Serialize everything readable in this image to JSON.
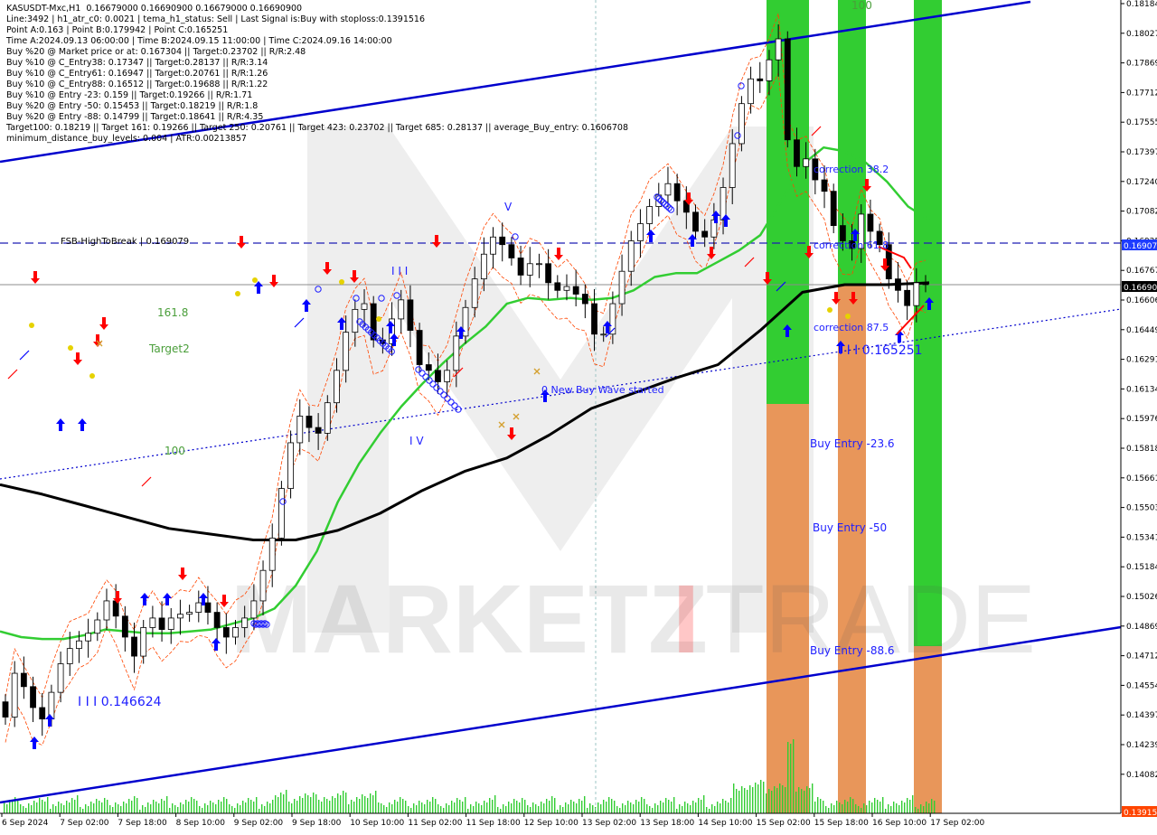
{
  "info_lines": [
    "KASUSDT-Mxc,H1  0.16679000 0.16690900 0.16679000 0.16690900",
    "Line:3492 | h1_atr_c0: 0.0021 | tema_h1_status: Sell | Last Signal is:Buy with stoploss:0.1391516",
    "Point A:0.163 | Point B:0.179942 | Point C:0.165251",
    "Time A:2024.09.13 06:00:00 | Time B:2024.09.15 11:00:00 | Time C:2024.09.16 14:00:00",
    "Buy %20 @ Market price or at: 0.167304 || Target:0.23702 || R/R:2.48",
    "Buy %10 @ C_Entry38: 0.17347 || Target:0.28137 || R/R:3.14",
    "Buy %10 @ C_Entry61: 0.16947 || Target:0.20761 || R/R:1.26",
    "Buy %10 @ C_Entry88: 0.16512 || Target:0.19688 || R/R:1.22",
    "Buy %10 @ Entry -23: 0.159 || Target:0.19266 || R/R:1.71",
    "Buy %20 @ Entry -50: 0.15453 || Target:0.18219 || R/R:1.8",
    "Buy %20 @ Entry -88: 0.14799 || Target:0.18641 || R/R:4.35",
    "Target100: 0.18219 || Target 161: 0.19266 || Target 250: 0.20761 || Target 423: 0.23702 || Target 685: 0.28137 || average_Buy_entry: 0.1606708",
    "minimum_distance_buy_levels: 0.004 | ATR:0.00213857"
  ],
  "watermark": {
    "part1": "MARKETZ",
    "part2": "I",
    "part3": "TRADE"
  },
  "chart_data": {
    "type": "candlestick",
    "symbol": "KASUSDT-Mxc",
    "timeframe": "H1",
    "ylim": [
      0.13915,
      0.18184
    ],
    "y_ticks": [
      "0.18184",
      "0.18027",
      "0.17869",
      "0.17712",
      "0.17555",
      "0.17397",
      "0.17240",
      "0.17082",
      "0.16925",
      "0.16767",
      "0.16606",
      "0.16449",
      "0.16291",
      "0.16134",
      "0.15976",
      "0.15818",
      "0.15661",
      "0.15503",
      "0.15341",
      "0.15184",
      "0.15026",
      "0.14869",
      "0.14712",
      "0.14554",
      "0.14397",
      "0.14239",
      "0.14082"
    ],
    "x_ticks": [
      "6 Sep 2024",
      "7 Sep 02:00",
      "7 Sep 18:00",
      "8 Sep 10:00",
      "9 Sep 02:00",
      "9 Sep 18:00",
      "10 Sep 10:00",
      "11 Sep 02:00",
      "11 Sep 18:00",
      "12 Sep 10:00",
      "13 Sep 02:00",
      "13 Sep 18:00",
      "14 Sep 10:00",
      "15 Sep 02:00",
      "15 Sep 18:00",
      "16 Sep 10:00",
      "17 Sep 02:00"
    ],
    "current_price": "0.16690",
    "bottom_price": "0.13915",
    "levels": {
      "fsb_label": "FSB-HighToBreak | 0.169079",
      "fsb_price": "0.16907",
      "fsb_value": 0.169079,
      "current_value": 0.1669
    },
    "annotations": {
      "fib_161": "161.8",
      "target2": "Target2",
      "fib_100": "100",
      "wave_III": "I I I",
      "wave_IV": "I V",
      "wave_V": "V",
      "new_buy_wave": "0 New Buy Wave started",
      "wave_0146624": "I I I 0.146624",
      "wave_0165251": "I I I 0.165251",
      "correction_382": "correction 38.2",
      "correction_618": "correction 61.8",
      "correction_875": "correction 87.5",
      "buy_entry_236": "Buy Entry -23.6",
      "buy_entry_50": "Buy Entry -50",
      "buy_entry_886": "Buy Entry -88.6",
      "top_100": "100"
    },
    "colors": {
      "candle": "#000000",
      "ma_green": "#32cd32",
      "ma_black": "#000000",
      "channel": "#0000cd",
      "envelope": "#ff4500",
      "zone_green": "#32cd32",
      "zone_orange": "#e8965a",
      "arrow_buy": "#0000ff",
      "arrow_sell": "#ff0000",
      "price_box": "#1e3cff",
      "bottom_box": "#ff4500"
    },
    "series": [
      {
        "name": "close",
        "values": [
          0.1442,
          0.1465,
          0.1458,
          0.1447,
          0.1441,
          0.1455,
          0.147,
          0.1478,
          0.1482,
          0.1486,
          0.1493,
          0.1503,
          0.1495,
          0.1484,
          0.1474,
          0.1489,
          0.1494,
          0.1488,
          0.1494,
          0.1496,
          0.1497,
          0.1502,
          0.1497,
          0.1489,
          0.1484,
          0.1489,
          0.1494,
          0.1503,
          0.1519,
          0.1536,
          0.1562,
          0.1586,
          0.16,
          0.1594,
          0.1591,
          0.1607,
          0.1624,
          0.1644,
          0.1656,
          0.1659,
          0.164,
          0.1638,
          0.1651,
          0.1661,
          0.1645,
          0.1627,
          0.1624,
          0.1618,
          0.1624,
          0.1642,
          0.1657,
          0.1672,
          0.1685,
          0.1694,
          0.169,
          0.1683,
          0.1674,
          0.168,
          0.168,
          0.167,
          0.1666,
          0.1668,
          0.1664,
          0.1659,
          0.1643,
          0.1643,
          0.1659,
          0.1676,
          0.1692,
          0.1701,
          0.171,
          0.1716,
          0.1722,
          0.1713,
          0.1707,
          0.1697,
          0.1694,
          0.1703,
          0.172,
          0.1743,
          0.1764,
          0.1777,
          0.1776,
          0.1787,
          0.1798,
          0.1745,
          0.1731,
          0.1735,
          0.1724,
          0.1718,
          0.17,
          0.1692,
          0.1688,
          0.1706,
          0.1697,
          0.169,
          0.1672,
          0.1666,
          0.1658,
          0.167,
          0.1669
        ]
      },
      {
        "name": "MA green",
        "values": [
          0.1487,
          0.1484,
          0.1483,
          0.1483,
          0.1485,
          0.1488,
          0.1487,
          0.1486,
          0.1486,
          0.1487,
          0.1488,
          0.1491,
          0.1494,
          0.1499,
          0.1511,
          0.1529,
          0.1555,
          0.1575,
          0.1591,
          0.1605,
          0.1617,
          0.1628,
          0.1638,
          0.1647,
          0.1659,
          0.1662,
          0.1661,
          0.1662,
          0.1661,
          0.1662,
          0.1666,
          0.1673,
          0.1675,
          0.1675,
          0.1681,
          0.1687,
          0.1695,
          0.1713,
          0.1732,
          0.1741,
          0.1739,
          0.1733,
          0.1723,
          0.171,
          0.1703
        ]
      },
      {
        "name": "MA black",
        "values": [
          0.1564,
          0.1559,
          0.1553,
          0.1547,
          0.1541,
          0.1538,
          0.1535,
          0.1535,
          0.154,
          0.1549,
          0.1561,
          0.1571,
          0.1578,
          0.159,
          0.1604,
          0.1612,
          0.162,
          0.1627,
          0.1645,
          0.1665,
          0.1669,
          0.1669,
          0.167
        ]
      }
    ]
  }
}
